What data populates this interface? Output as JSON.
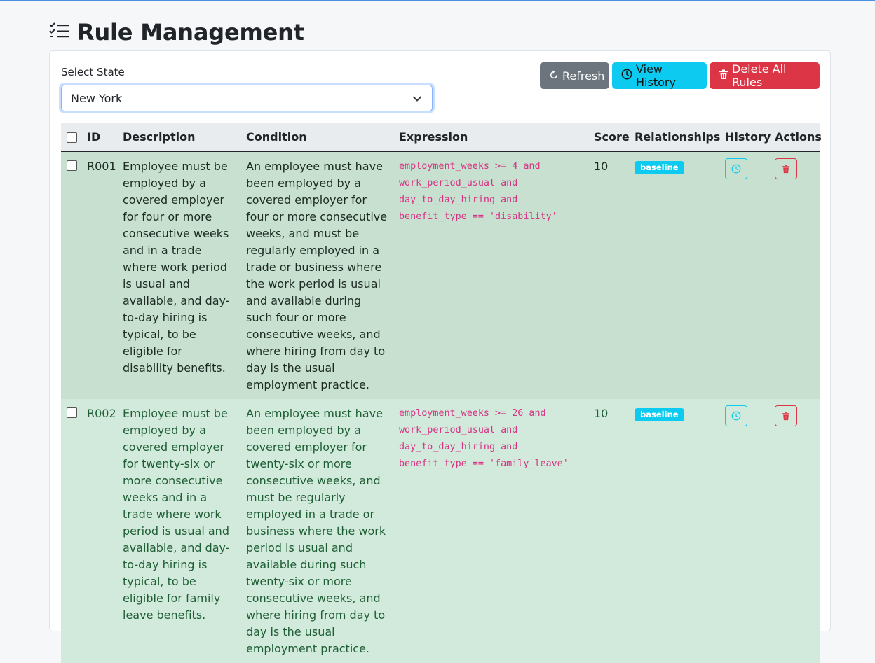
{
  "page": {
    "title": "Rule Management"
  },
  "state_selector": {
    "label": "Select State",
    "value": "New York"
  },
  "toolbar": {
    "refresh_label": "Refresh",
    "view_history_label": "View History",
    "delete_all_label": "Delete All Rules"
  },
  "table": {
    "headers": {
      "id": "ID",
      "description": "Description",
      "condition": "Condition",
      "expression": "Expression",
      "score": "Score",
      "relationships": "Relationships",
      "history": "History",
      "actions": "Actions"
    },
    "rows": [
      {
        "id": "R001",
        "description": "Employee must be employed by a covered employer for four or more consecutive weeks and in a trade where work period is usual and available, and day-to-day hiring is typical, to be eligible for disability benefits.",
        "condition": "An employee must have been employed by a covered employer for four or more consecutive weeks, and must be regularly employed in a trade or business where the work period is usual and available during such four or more consecutive weeks, and where hiring from day to day is the usual employment practice.",
        "expression": "employment_weeks >= 4 and work_period_usual and day_to_day_hiring and benefit_type == 'disability'",
        "score": "10",
        "relationship": "baseline"
      },
      {
        "id": "R002",
        "description": "Employee must be employed by a covered employer for twenty-six or more consecutive weeks and in a trade where work period is usual and available, and day-to-day hiring is typical, to be eligible for family leave benefits.",
        "condition": "An employee must have been employed by a covered employer for twenty-six or more consecutive weeks, and must be regularly employed in a trade or business where the work period is usual and available during such twenty-six or more consecutive weeks, and where hiring from day to day is the usual employment practice.",
        "expression": "employment_weeks >= 26 and work_period_usual and day_to_day_hiring and benefit_type == 'family_leave'",
        "score": "10",
        "relationship": "baseline"
      }
    ]
  },
  "icons": {
    "title": "checklist-icon",
    "select": "chevron-down-icon",
    "refresh": "refresh-icon",
    "history": "clock-icon",
    "delete": "trash-icon"
  },
  "colors": {
    "secondary": "#6c757d",
    "info": "#0dcaf0",
    "danger": "#dc3545",
    "row_active": "#c7e0cf",
    "row_success": "#d2eadb",
    "code": "#d63384"
  }
}
